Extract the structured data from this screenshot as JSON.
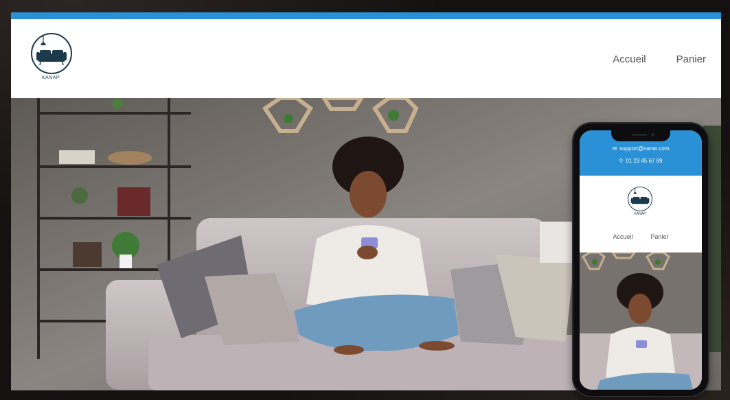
{
  "site": {
    "brand": "KANAP",
    "nav": {
      "home_label": "Accueil",
      "cart_label": "Panier"
    },
    "accent_color": "#2a91d6"
  },
  "mobile": {
    "contact": {
      "email": "support@name.com",
      "phone": "01 23 45 67 89"
    },
    "brand": "KANAP",
    "nav": {
      "home_label": "Accueil",
      "cart_label": "Panier"
    }
  },
  "hero": {
    "image": "woman-on-sofa-with-phone"
  },
  "icons": [
    "envelope-icon",
    "location-pin-icon",
    "sofa-logo-icon"
  ]
}
